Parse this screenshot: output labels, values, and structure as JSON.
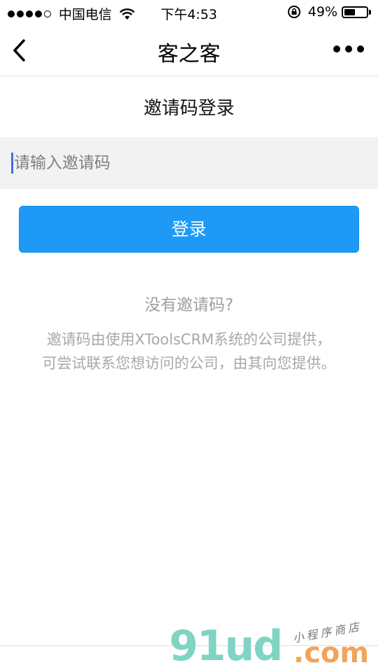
{
  "status": {
    "carrier": "中国电信",
    "time": "下午4:53",
    "battery_percent": "49%",
    "battery_level": 0.49,
    "signal_bars": 4
  },
  "nav": {
    "title": "客之客"
  },
  "login": {
    "section_title": "邀请码登录",
    "input_placeholder": "请输入邀请码",
    "input_value": "",
    "button_label": "登录"
  },
  "help": {
    "title": "没有邀请码?",
    "description": "邀请码由使用XToolsCRM系统的公司提供，可尝试联系您想访问的公司，由其向您提供。"
  },
  "watermark": {
    "logo": "91ud",
    "tagline": "小程序商店",
    "domain": ".com"
  },
  "colors": {
    "accent": "#1e9af6",
    "input_bg": "#f2f2f2",
    "muted_text": "#a8a8a8"
  }
}
